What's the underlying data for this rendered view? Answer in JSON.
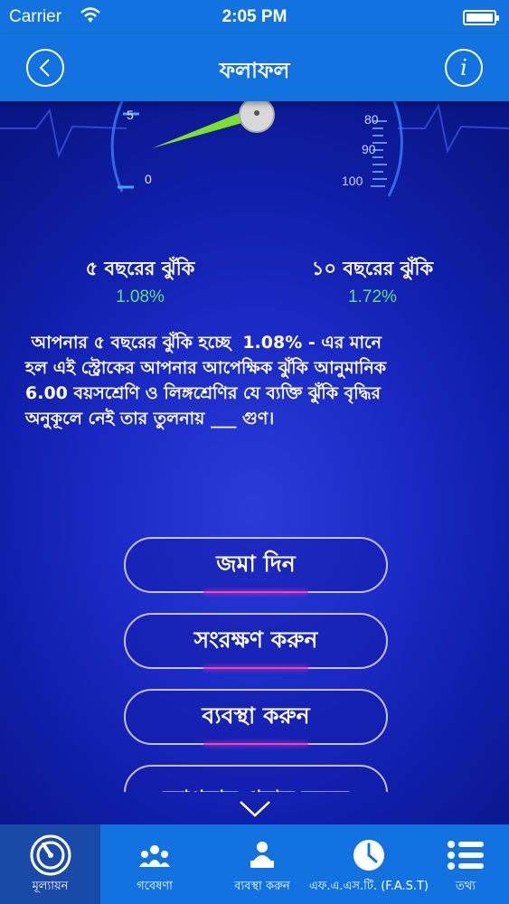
{
  "status_bar": {
    "carrier": "Carrier",
    "time": "2:05 PM"
  },
  "header": {
    "title": "ফলাফল",
    "back_icon": "chevron-left-icon",
    "info_icon": "info-icon"
  },
  "gauges": {
    "left_ticks": [
      "5",
      "0"
    ],
    "right_ticks": [
      "80",
      "90",
      "100"
    ]
  },
  "risk": {
    "five_year_label": "৫ বছরের ঝুঁকি",
    "five_year_value": "1.08%",
    "ten_year_label": "১০ বছরের ঝুঁকি",
    "ten_year_value": "1.72%"
  },
  "description": " আপনার ৫ বছরের ঝুঁকি হচ্ছে  1.08% - এর মানে\nহল এই স্ট্রোকের আপনার আপেক্ষিক ঝুঁকি আনুমানিক\n6.00 বয়সশ্রেণি ও লিঙ্গশ্রেণির যে ব্যক্তি ঝুঁকি বৃদ্ধির\nঅনুকূলে নেই তার তুলনায় ___ গুণ।",
  "actions": {
    "submit": "জমা দিন",
    "save": "সংরক্ষণ করুন",
    "manage": "ব্যবস্থা করুন",
    "share_partial": "আপনার প্রদান করুন"
  },
  "tabs": [
    {
      "label": "মূল্যায়ন",
      "icon": "gauge-icon",
      "active": true
    },
    {
      "label": "গবেষণা",
      "icon": "people-network-icon",
      "active": false
    },
    {
      "label": "ব্যবস্থা করুন",
      "icon": "person-laptop-icon",
      "active": false
    },
    {
      "label": "এফ.এ.এস.টি. (F.A.S.T)",
      "icon": "clock-icon",
      "active": false
    },
    {
      "label": "তথ্য",
      "icon": "list-icon",
      "active": false
    }
  ],
  "colors": {
    "bar_blue": "#1273e0",
    "risk_green": "#5fe07c",
    "background": "#1a2ac4",
    "needle": "#7fe02a"
  }
}
